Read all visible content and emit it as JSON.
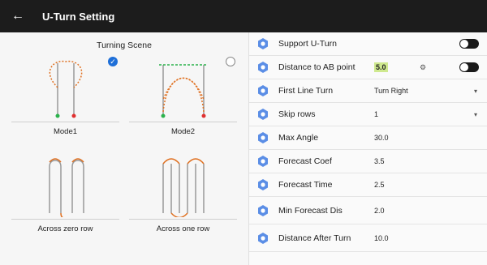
{
  "header": {
    "back_label": "←",
    "title": "U-Turn Setting"
  },
  "scene": {
    "title": "Turning Scene",
    "modes": [
      {
        "label": "Mode1",
        "selected": true
      },
      {
        "label": "Mode2",
        "selected": false
      },
      {
        "label": "Across zero row",
        "selected": false
      },
      {
        "label": "Across one row",
        "selected": false
      }
    ]
  },
  "settings": [
    {
      "label": "Support U-Turn",
      "value": "",
      "control": "toggle"
    },
    {
      "label": "Distance to AB point",
      "value": "5.0",
      "control": "toggle"
    },
    {
      "label": "First Line Turn",
      "value": "Turn Right",
      "control": "dropdown"
    },
    {
      "label": "Skip rows",
      "value": "1",
      "control": "dropdown"
    },
    {
      "label": "Max Angle",
      "value": "30.0",
      "control": "input"
    },
    {
      "label": "Forecast Coef",
      "value": "3.5",
      "control": "input"
    },
    {
      "label": "Forecast Time",
      "value": "2.5",
      "control": "input"
    },
    {
      "label": "Min Forecast Dis",
      "value": "2.0",
      "control": "input"
    },
    {
      "label": "Distance After Turn",
      "value": "10.0",
      "control": "input"
    }
  ],
  "icons": {
    "settings": "gear-icon",
    "dropdown": "caret-down-icon",
    "back": "arrow-left-icon",
    "check": "check-icon"
  },
  "colors": {
    "topbar": "#1c1c1c",
    "accent": "#1e6fd8",
    "highlight": "#cfe98f",
    "toggle": "#1a1a1a"
  }
}
